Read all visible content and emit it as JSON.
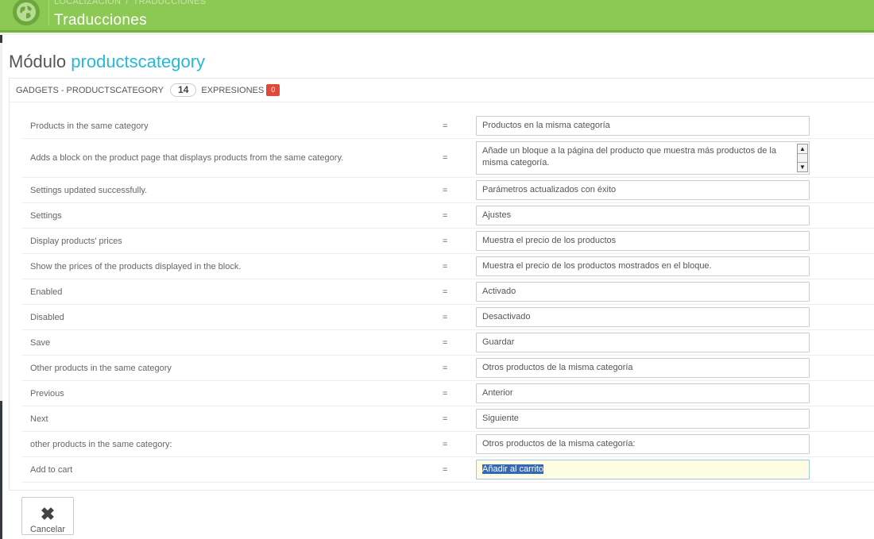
{
  "header": {
    "breadcrumb": [
      "LOCALIZACIÓN",
      "TRADUCCIONES"
    ],
    "title": "Traducciones",
    "icon": "globe-icon"
  },
  "module": {
    "prefix": "Módulo",
    "name": "productscategory"
  },
  "panel": {
    "heading_label": "GADGETS - PRODUCTSCATEGORY",
    "count": "14",
    "expressions_label": "EXPRESIONES",
    "expressions_missing": "0"
  },
  "rows": [
    {
      "source": "Products in the same category",
      "eq": "=",
      "value": "Productos en la misma categoría"
    },
    {
      "source": "Adds a block on the product page that displays products from the same category.",
      "eq": "=",
      "value": "Añade un bloque a la página del producto que muestra más productos de la misma categoría."
    },
    {
      "source": "Settings updated successfully.",
      "eq": "=",
      "value": "Parámetros actualizados con éxito"
    },
    {
      "source": "Settings",
      "eq": "=",
      "value": "Ajustes"
    },
    {
      "source": "Display products' prices",
      "eq": "=",
      "value": "Muestra el precio de los productos"
    },
    {
      "source": "Show the prices of the products displayed in the block.",
      "eq": "=",
      "value": "Muestra el precio de los productos mostrados en el bloque."
    },
    {
      "source": "Enabled",
      "eq": "=",
      "value": "Activado"
    },
    {
      "source": "Disabled",
      "eq": "=",
      "value": "Desactivado"
    },
    {
      "source": "Save",
      "eq": "=",
      "value": "Guardar"
    },
    {
      "source": "Other products in the same category",
      "eq": "=",
      "value": "Otros productos de la misma categoría"
    },
    {
      "source": "Previous",
      "eq": "=",
      "value": "Anterior"
    },
    {
      "source": "Next",
      "eq": "=",
      "value": "Siguiente"
    },
    {
      "source": "other products in the same category:",
      "eq": "=",
      "value": "Otros productos de la misma categoría:"
    },
    {
      "source": "Add to cart",
      "eq": "=",
      "value": "Añadir al carrito"
    }
  ],
  "footer": {
    "cancel_label": "Cancelar",
    "cancel_icon": "close-icon"
  },
  "colors": {
    "header_bg": "#8bc954",
    "accent": "#25b9d7",
    "badge_red": "#e3473a"
  }
}
